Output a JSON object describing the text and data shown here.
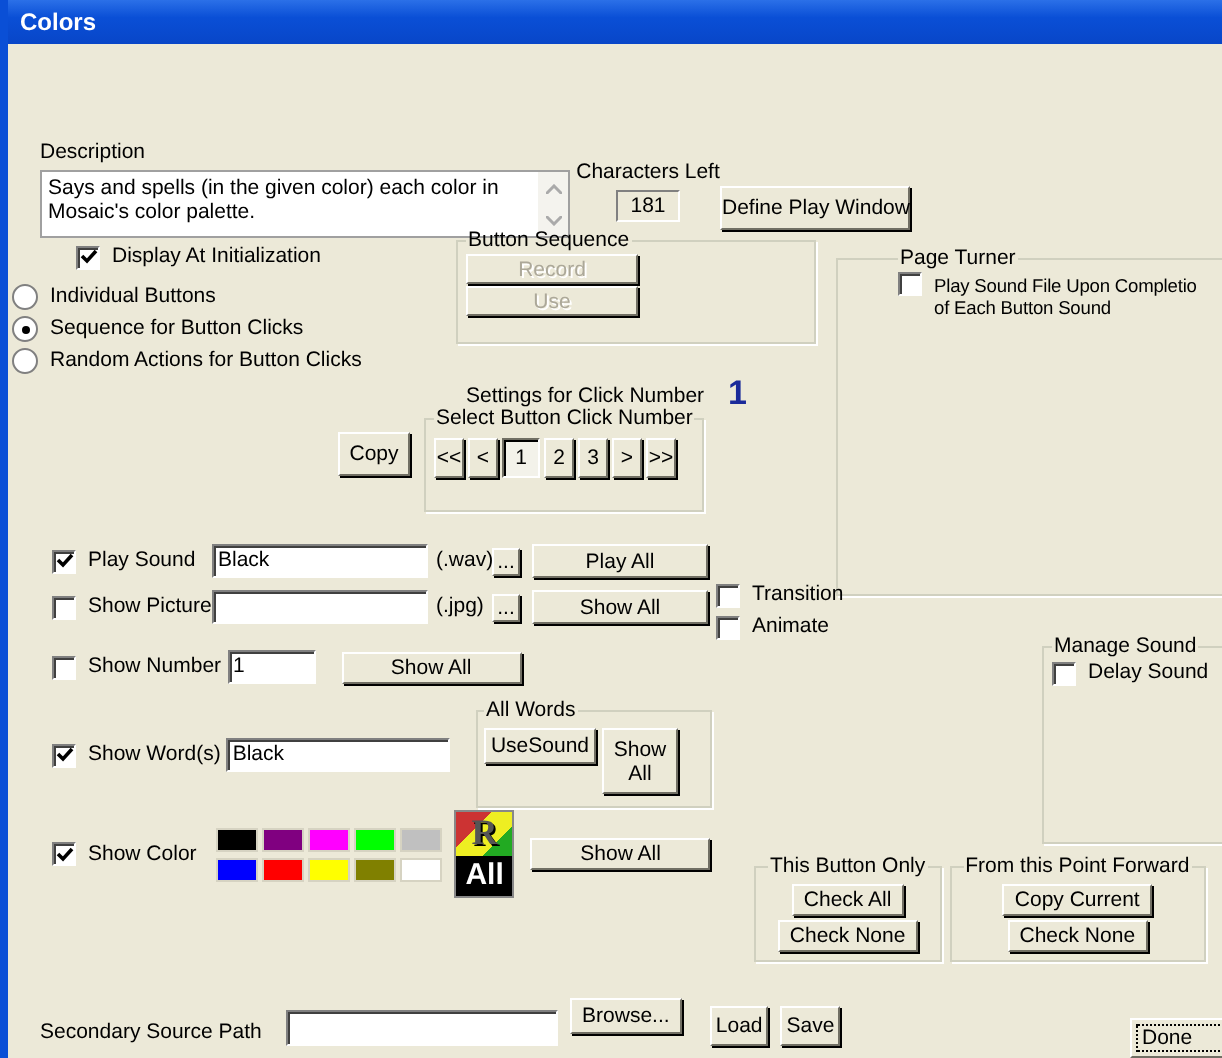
{
  "window": {
    "title": "Colors"
  },
  "description": {
    "label": "Description",
    "value": "Says and spells (in the given color) each color in Mosaic's color palette."
  },
  "characters_left": {
    "label": "Characters Left",
    "value": "181"
  },
  "define_play_window": "Define Play Window",
  "display_at_init": {
    "label": "Display At Initialization",
    "checked": true
  },
  "modes": [
    {
      "label": "Individual Buttons",
      "selected": false
    },
    {
      "label": "Sequence for Button Clicks",
      "selected": true
    },
    {
      "label": "Random Actions for Button Clicks",
      "selected": false
    }
  ],
  "button_sequence": {
    "title": "Button Sequence",
    "buttons": [
      {
        "label": "Record",
        "disabled": true
      },
      {
        "label": "Use",
        "disabled": true
      }
    ]
  },
  "page_turner": {
    "title": "Page Turner",
    "option": {
      "lines": [
        "Play Sound File Upon Completio",
        "of Each Button Sound"
      ],
      "checked": false
    }
  },
  "settings": {
    "label": "Settings for Click Number",
    "number": "1"
  },
  "copy_button": "Copy",
  "click_select": {
    "title": "Select Button Click Number",
    "buttons": [
      {
        "label": "<<",
        "selected": false
      },
      {
        "label": "<",
        "selected": false
      },
      {
        "label": "1",
        "selected": true
      },
      {
        "label": "2",
        "selected": false
      },
      {
        "label": "3",
        "selected": false
      },
      {
        "label": ">",
        "selected": false
      },
      {
        "label": ">>",
        "selected": false
      }
    ]
  },
  "media_rows": [
    {
      "label": "Play Sound",
      "checked": true,
      "value": "Black",
      "ext": "(.wav)",
      "browse": "...",
      "action": "Play All"
    },
    {
      "label": "Show Picture",
      "checked": false,
      "ext": "(.jpg)",
      "browse": "...",
      "action": "Show All"
    }
  ],
  "transition": {
    "label": "Transition",
    "checked": false
  },
  "animate": {
    "label": "Animate",
    "checked": false
  },
  "show_number": {
    "label": "Show Number",
    "checked": false,
    "value": "1",
    "action": "Show All"
  },
  "all_words": {
    "title": "All Words",
    "buttons": [
      "UseSound",
      "Show All"
    ]
  },
  "show_words": {
    "label": "Show Word(s)",
    "checked": true,
    "value": "Black"
  },
  "show_color": {
    "label": "Show Color",
    "checked": true,
    "action": "Show All",
    "swatches": [
      {
        "color": "#000000"
      },
      {
        "color": "#800080"
      },
      {
        "color": "#ff00ff"
      },
      {
        "color": "#00ff00"
      },
      {
        "color": "#c0c0c0"
      },
      {
        "color": "#0000ff"
      },
      {
        "color": "#ff0000"
      },
      {
        "color": "#ffff00"
      },
      {
        "color": "#808000"
      },
      {
        "color": "#ffffff"
      }
    ],
    "palette_icon": {
      "letter": "R",
      "caption": "All"
    }
  },
  "manage_sound": {
    "title": "Manage Sound",
    "option": {
      "label": "Delay Sound",
      "checked": false
    }
  },
  "this_button_only": {
    "title": "This Button Only",
    "buttons": [
      "Check All",
      "Check None"
    ]
  },
  "from_this_point": {
    "title": "From this Point Forward",
    "buttons": [
      "Copy Current",
      "Check None"
    ]
  },
  "secondary_source": {
    "label": "Secondary Source Path",
    "browse": "Browse..."
  },
  "load": "Load",
  "save": "Save",
  "done": "Done"
}
